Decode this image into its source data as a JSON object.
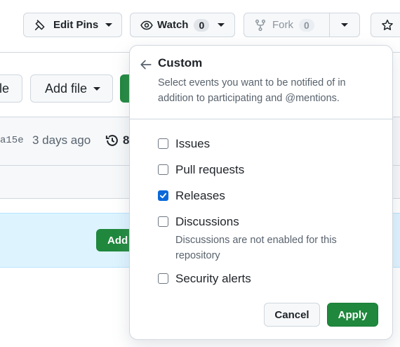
{
  "toolbar": {
    "edit_pins_label": "Edit Pins",
    "watch_label": "Watch",
    "watch_count": "0",
    "fork_label": "Fork",
    "fork_count": "0"
  },
  "repo": {
    "add_file_label": "Add file",
    "file_button_partial": "le",
    "commit_hash": "a15e",
    "commit_time": "3 days ago",
    "commit_count_partial": "8",
    "banner_button_partial": "Add"
  },
  "menu": {
    "title": "Custom",
    "description": "Select events you want to be notified of in addition to participating and @mentions.",
    "options": [
      {
        "label": "Issues",
        "checked": false
      },
      {
        "label": "Pull requests",
        "checked": false
      },
      {
        "label": "Releases",
        "checked": true
      },
      {
        "label": "Discussions",
        "checked": false,
        "note": "Discussions are not enabled for this repository"
      },
      {
        "label": "Security alerts",
        "checked": false
      }
    ],
    "cancel_label": "Cancel",
    "apply_label": "Apply"
  },
  "colors": {
    "accent_blue": "#0969da",
    "primary_green": "#1f883d",
    "banner_bg": "#ddf4ff"
  }
}
